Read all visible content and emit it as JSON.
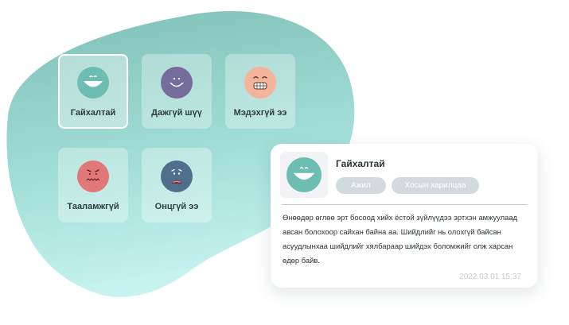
{
  "colors": {
    "blob_top": "#7fbfb6",
    "blob_bottom": "#c6f3ef",
    "great": "#6dbdb3",
    "bored": "#746d9c",
    "confused": "#f3b49b",
    "unpleasant": "#e27777",
    "sad": "#4f6f8d",
    "tag_bg": "#d3dadd"
  },
  "moods": [
    {
      "label": "Гайхалтай",
      "icon": "happy-face-icon",
      "selected": true
    },
    {
      "label": "Дажгүй шүү",
      "icon": "content-face-icon",
      "selected": false
    },
    {
      "label": "Мэдэхгүй ээ",
      "icon": "grimace-face-icon",
      "selected": false
    },
    {
      "label": "Тааламжгүй",
      "icon": "upset-face-icon",
      "selected": false
    },
    {
      "label": "Онцгүй ээ",
      "icon": "sad-face-icon",
      "selected": false
    }
  ],
  "entry": {
    "mood": "Гайхалтай",
    "icon": "happy-face-icon",
    "tags": [
      "Ажил",
      "Хосын харилцаа"
    ],
    "text": "Өнөөдөр өглөө эрт босоод хийх ёстой зүйлүүдээ эртхэн амжуулаад авсан болохоор сайхан байна аа. Шийдлийг нь олохгүй байсан асуудлынхаа шийдлийг хялбараар шийдэх боломжийг олж харсан өдөр байв.",
    "timestamp": "2022.03.01  15:37"
  }
}
